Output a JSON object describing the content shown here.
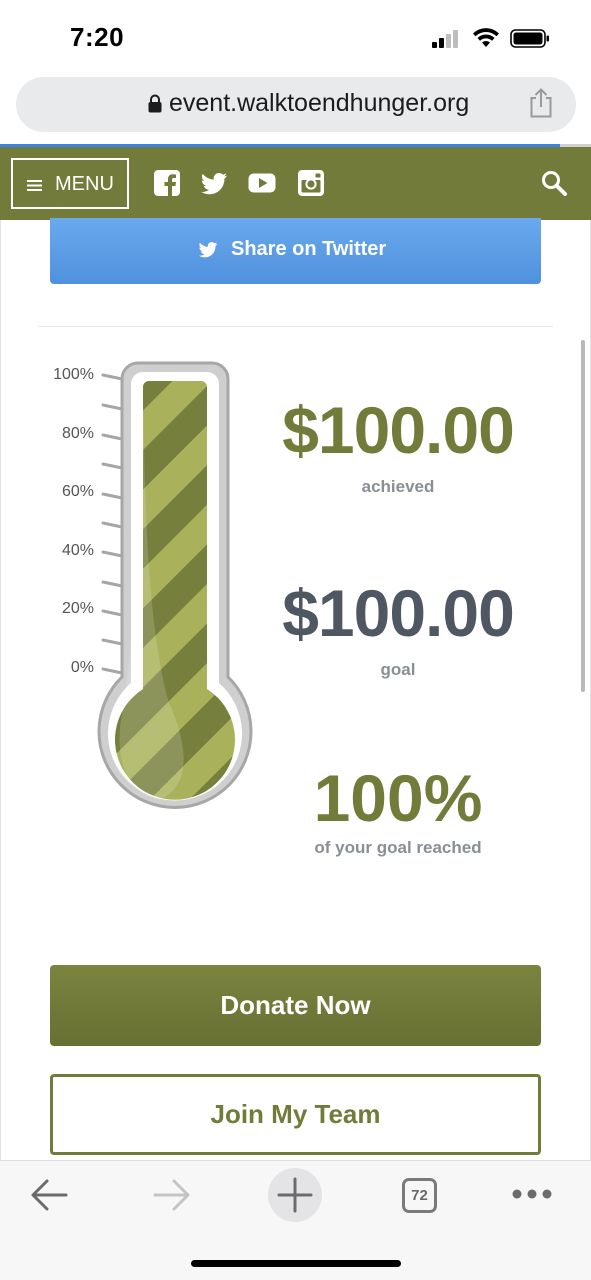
{
  "status_bar": {
    "time": "7:20"
  },
  "browser": {
    "url": "event.walktoendhunger.org",
    "tab_count": "72"
  },
  "header": {
    "menu_label": "MENU",
    "social_icons": [
      "facebook-icon",
      "twitter-icon",
      "youtube-icon",
      "instagram-icon"
    ],
    "brand_color": "#737b3b"
  },
  "share": {
    "twitter_label": "Share on Twitter"
  },
  "thermometer": {
    "scale_labels": [
      "100%",
      "80%",
      "60%",
      "40%",
      "20%",
      "0%"
    ],
    "progress_fraction": 1.0
  },
  "stats": {
    "achieved_amount": "$100.00",
    "achieved_label": "achieved",
    "goal_amount": "$100.00",
    "goal_label": "goal",
    "percent": "100%",
    "percent_label": "of your goal reached"
  },
  "actions": {
    "donate_label": "Donate Now",
    "join_label": "Join My Team"
  },
  "colors": {
    "olive": "#737b3b",
    "slate": "#4f5762",
    "twitter_blue": "#5a9be4"
  }
}
